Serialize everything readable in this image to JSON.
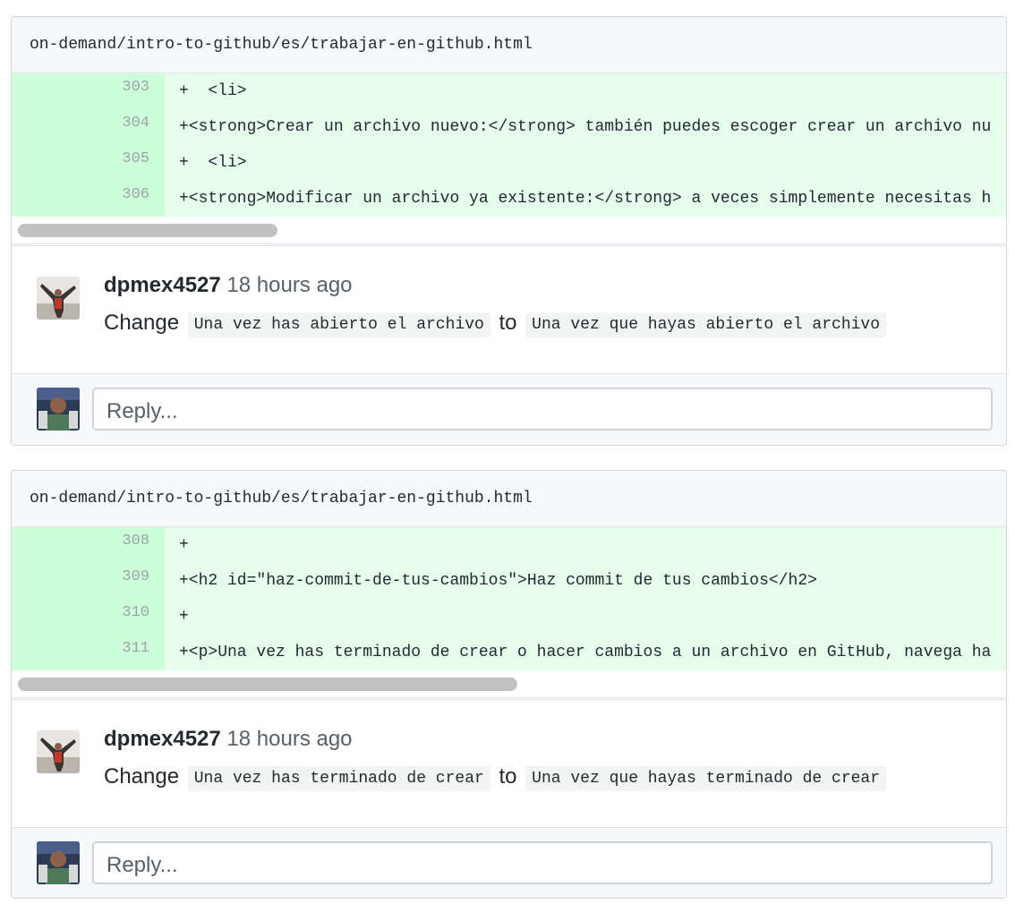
{
  "threads": [
    {
      "file_path": "on-demand/intro-to-github/es/trabajar-en-github.html",
      "lines": [
        {
          "num": "303",
          "code": "+  <li>"
        },
        {
          "num": "304",
          "code": "+<strong>Crear un archivo nuevo:</strong> también puedes escoger crear un archivo nu"
        },
        {
          "num": "305",
          "code": "+  <li>"
        },
        {
          "num": "306",
          "code": "+<strong>Modificar un archivo ya existente:</strong> a veces simplemente necesitas h"
        }
      ],
      "comment": {
        "author": "dpmex4527",
        "time": "18 hours ago",
        "change_word": "Change",
        "from_text": "Una vez has abierto el archivo",
        "to_word": "to",
        "to_text": "Una vez que hayas abierto el archivo"
      },
      "reply_placeholder": "Reply..."
    },
    {
      "file_path": "on-demand/intro-to-github/es/trabajar-en-github.html",
      "lines": [
        {
          "num": "308",
          "code": "+"
        },
        {
          "num": "309",
          "code": "+<h2 id=\"haz-commit-de-tus-cambios\">Haz commit de tus cambios</h2>"
        },
        {
          "num": "310",
          "code": "+"
        },
        {
          "num": "311",
          "code": "+<p>Una vez has terminado de crear o hacer cambios a un archivo en GitHub, navega ha"
        }
      ],
      "comment": {
        "author": "dpmex4527",
        "time": "18 hours ago",
        "change_word": "Change",
        "from_text": "Una vez has terminado de crear",
        "to_word": "to",
        "to_text": "Una vez que hayas terminado de crear"
      },
      "reply_placeholder": "Reply..."
    }
  ],
  "colors": {
    "added_line_bg": "#e6ffed",
    "added_num_bg": "#cdffd8",
    "header_bg": "#f6f8fa",
    "border": "#d1d5da"
  },
  "icons": {
    "commenter_avatar": "user-avatar-icon",
    "reply_avatar": "current-user-avatar-icon"
  }
}
